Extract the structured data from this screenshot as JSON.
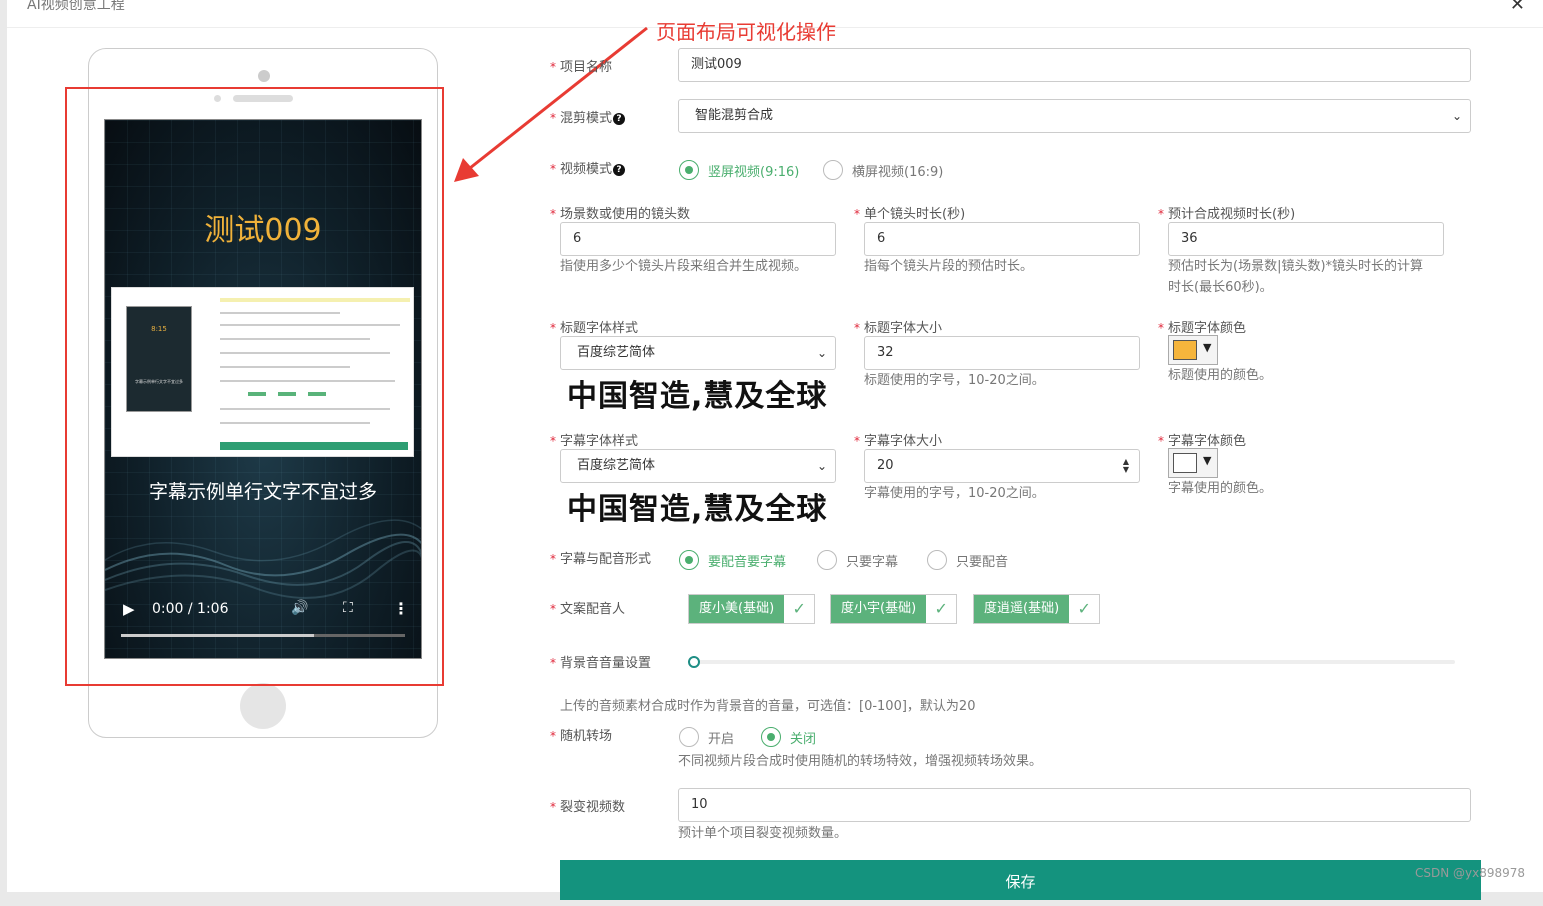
{
  "window": {
    "title": "AI视频创意工程",
    "close": "✕"
  },
  "annotation": {
    "text": "页面布局可视化操作"
  },
  "preview": {
    "title": "测试009",
    "subtitle": "字幕示例单行文字不宜过多",
    "mini_time": "8:15",
    "mini_subtitle": "字幕示例单行文字不宜过多",
    "time": "0:00 / 1:06",
    "progress": 0.68
  },
  "form": {
    "project_name": {
      "label": "项目名称",
      "value": "测试009"
    },
    "mix_mode": {
      "label": "混剪模式",
      "value": "智能混剪合成"
    },
    "video_mode": {
      "label": "视频模式",
      "options": [
        "竖屏视频(9:16)",
        "横屏视频(16:9)"
      ],
      "selected": 0
    },
    "scene_count": {
      "label": "场景数或使用的镜头数",
      "value": "6",
      "note": "指使用多少个镜头片段来组合并生成视频。"
    },
    "shot_duration": {
      "label": "单个镜头时长(秒)",
      "value": "6",
      "note": "指每个镜头片段的预估时长。"
    },
    "total_duration": {
      "label": "预计合成视频时长(秒)",
      "value": "36",
      "note1": "预估时长为(场景数|镜头数)*镜头时长的计算",
      "note2": "时长(最长60秒)。"
    },
    "title_font": {
      "label": "标题字体样式",
      "value": "百度综艺简体",
      "sample": "中国智造,慧及全球"
    },
    "title_size": {
      "label": "标题字体大小",
      "value": "32",
      "note": "标题使用的字号，10-20之间。"
    },
    "title_color": {
      "label": "标题字体颜色",
      "color": "#f6b53c",
      "note": "标题使用的颜色。"
    },
    "sub_font": {
      "label": "字幕字体样式",
      "value": "百度综艺简体",
      "sample": "中国智造,慧及全球"
    },
    "sub_size": {
      "label": "字幕字体大小",
      "value": "20",
      "note": "字幕使用的字号，10-20之间。"
    },
    "sub_color": {
      "label": "字幕字体颜色",
      "color": "#ffffff",
      "note": "字幕使用的颜色。"
    },
    "sub_voice_form": {
      "label": "字幕与配音形式",
      "options": [
        "要配音要字幕",
        "只要字幕",
        "只要配音"
      ],
      "selected": 0
    },
    "voice_actor": {
      "label": "文案配音人",
      "voices": [
        "度小美(基础)",
        "度小宇(基础)",
        "度逍遥(基础)"
      ]
    },
    "bgm_volume": {
      "label": "背景音音量设置",
      "value": 0,
      "note": "上传的音频素材合成时作为背景音的音量，可选值：[0-100]，默认为20"
    },
    "random_transition": {
      "label": "随机转场",
      "options": [
        "开启",
        "关闭"
      ],
      "selected": 1,
      "note": "不同视频片段合成时使用随机的转场特效，增强视频转场效果。"
    },
    "fission_count": {
      "label": "裂变视频数",
      "value": "10",
      "note": "预计单个项目裂变视频数量。"
    },
    "save": "保存"
  },
  "watermark": "CSDN @yx898978",
  "colors": {
    "accent": "#4aae6e",
    "primary": "#14937e",
    "annotation": "#e83b33"
  }
}
